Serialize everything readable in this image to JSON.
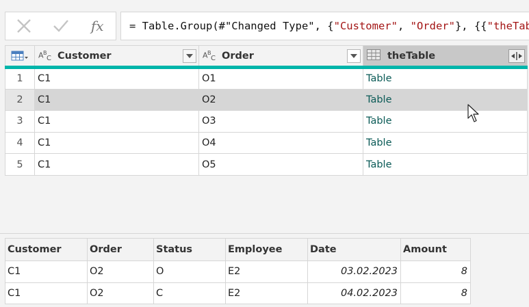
{
  "formula_bar": {
    "cancel_icon": "close-icon",
    "commit_icon": "check-icon",
    "fx_label": "fx",
    "formula_parts": [
      {
        "text": "= Table.Group(#\"Changed Type\", {",
        "kind": "plain"
      },
      {
        "text": "\"Customer\"",
        "kind": "str"
      },
      {
        "text": ", ",
        "kind": "plain"
      },
      {
        "text": "\"Order\"",
        "kind": "str"
      },
      {
        "text": "}, {{",
        "kind": "plain"
      },
      {
        "text": "\"theTable\"",
        "kind": "str"
      }
    ]
  },
  "grid": {
    "columns": [
      {
        "label": "Customer",
        "type_icon": "text-type-icon"
      },
      {
        "label": "Order",
        "type_icon": "text-type-icon"
      },
      {
        "label": "theTable",
        "type_icon": "table-type-icon"
      }
    ],
    "rows": [
      {
        "num": "1",
        "customer": "C1",
        "order": "O1",
        "table": "Table"
      },
      {
        "num": "2",
        "customer": "C1",
        "order": "O2",
        "table": "Table"
      },
      {
        "num": "3",
        "customer": "C1",
        "order": "O3",
        "table": "Table"
      },
      {
        "num": "4",
        "customer": "C1",
        "order": "O4",
        "table": "Table"
      },
      {
        "num": "5",
        "customer": "C1",
        "order": "O5",
        "table": "Table"
      }
    ],
    "highlighted_row": 2,
    "accent_color": "#00b5aa"
  },
  "preview": {
    "columns": [
      "Customer",
      "Order",
      "Status",
      "Employee",
      "Date",
      "Amount"
    ],
    "rows": [
      [
        "C1",
        "O2",
        "O",
        "E2",
        "03.02.2023",
        "8"
      ],
      [
        "C1",
        "O2",
        "C",
        "E2",
        "04.02.2023",
        "8"
      ]
    ]
  }
}
